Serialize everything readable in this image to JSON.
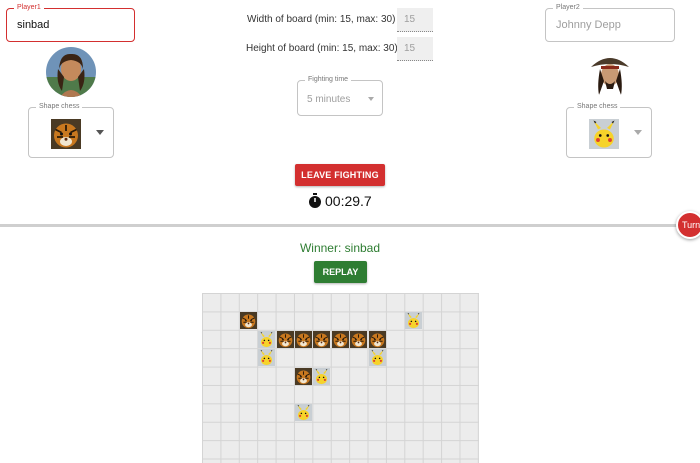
{
  "player1": {
    "legend": "Player1",
    "name": "sinbad"
  },
  "player2": {
    "legend": "Player2",
    "placeholder": "Johnny Depp"
  },
  "shape1": {
    "legend": "Shape chess",
    "piece": "tiger-icon"
  },
  "shape2": {
    "legend": "Shape chess",
    "piece": "pikachu-icon"
  },
  "board_settings": {
    "width_label": "Width of board (min: 15, max: 30)",
    "width_value": "15",
    "height_label": "Height of board (min: 15, max: 30)",
    "height_value": "15"
  },
  "fighting_time": {
    "legend": "Fighting time",
    "value": "5 minutes"
  },
  "leave_button": "LEAVE FIGHTING",
  "timer": "00:29.7",
  "turn_badge": "Turn",
  "winner_text": "Winner: sinbad",
  "replay_button": "REPLAY",
  "colors": {
    "accent_red": "#d32f2f",
    "success_green": "#2e7d32"
  },
  "board": {
    "size": 15,
    "pieces": [
      {
        "row": 1,
        "col": 2,
        "type": "tiger"
      },
      {
        "row": 1,
        "col": 11,
        "type": "pikachu"
      },
      {
        "row": 2,
        "col": 3,
        "type": "pikachu"
      },
      {
        "row": 2,
        "col": 4,
        "type": "tiger"
      },
      {
        "row": 2,
        "col": 5,
        "type": "tiger"
      },
      {
        "row": 2,
        "col": 6,
        "type": "tiger"
      },
      {
        "row": 2,
        "col": 7,
        "type": "tiger"
      },
      {
        "row": 2,
        "col": 8,
        "type": "tiger"
      },
      {
        "row": 2,
        "col": 9,
        "type": "tiger"
      },
      {
        "row": 3,
        "col": 3,
        "type": "pikachu"
      },
      {
        "row": 3,
        "col": 9,
        "type": "pikachu"
      },
      {
        "row": 4,
        "col": 5,
        "type": "tiger"
      },
      {
        "row": 4,
        "col": 6,
        "type": "pikachu"
      },
      {
        "row": 6,
        "col": 5,
        "type": "pikachu"
      }
    ]
  }
}
